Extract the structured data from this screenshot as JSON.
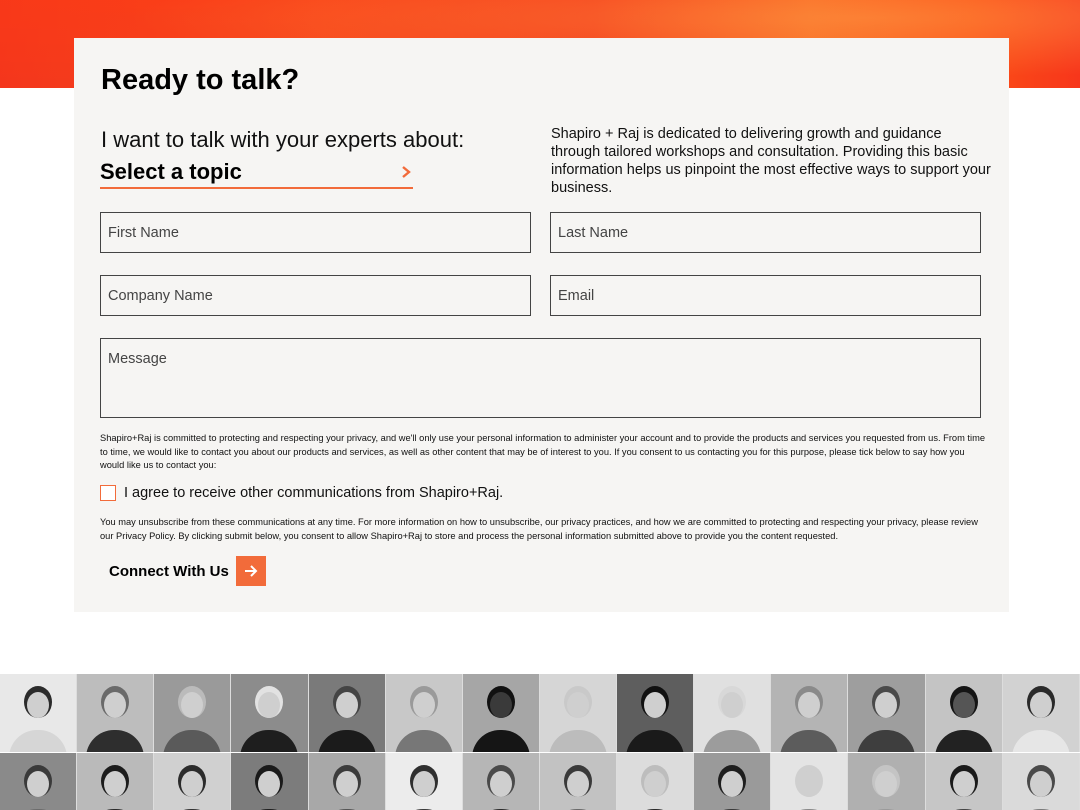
{
  "form": {
    "title": "Ready to talk?",
    "lead": "I want to talk with your experts about:",
    "topic_label": "Select a topic",
    "blurb": "Shapiro + Raj is dedicated to delivering growth and guidance through tailored workshops and consultation. Providing this basic information helps us pinpoint the most effective ways to support your business.",
    "fields": {
      "first_name": "First Name",
      "last_name": "Last Name",
      "company": "Company Name",
      "email": "Email",
      "message": "Message"
    },
    "privacy_text": "Shapiro+Raj is committed to protecting and respecting your privacy, and we'll only use your personal information to administer your account and to provide the products and services you requested from us. From time to time, we would like to contact you about our products and services, as well as other content that may be of interest to you. If you consent to us contacting you for this purpose, please tick below to say how you would like us to contact you:",
    "consent_label": "I agree to receive other communications from Shapiro+Raj.",
    "unsubscribe_text": "You may unsubscribe from these communications at any time. For more information on how to unsubscribe, our privacy practices, and how we are committed to protecting and respecting your privacy, please review our Privacy Policy. By clicking submit below, you consent to allow Shapiro+Raj to store and process the personal information submitted above to provide you the content requested.",
    "submit_label": "Connect With Us"
  },
  "icons": {
    "topic": "chevron-right-icon",
    "submit": "arrow-right-icon"
  },
  "colors": {
    "accent": "#f26b3a",
    "card_bg": "#f6f5f3",
    "hero": "#f4361c"
  }
}
